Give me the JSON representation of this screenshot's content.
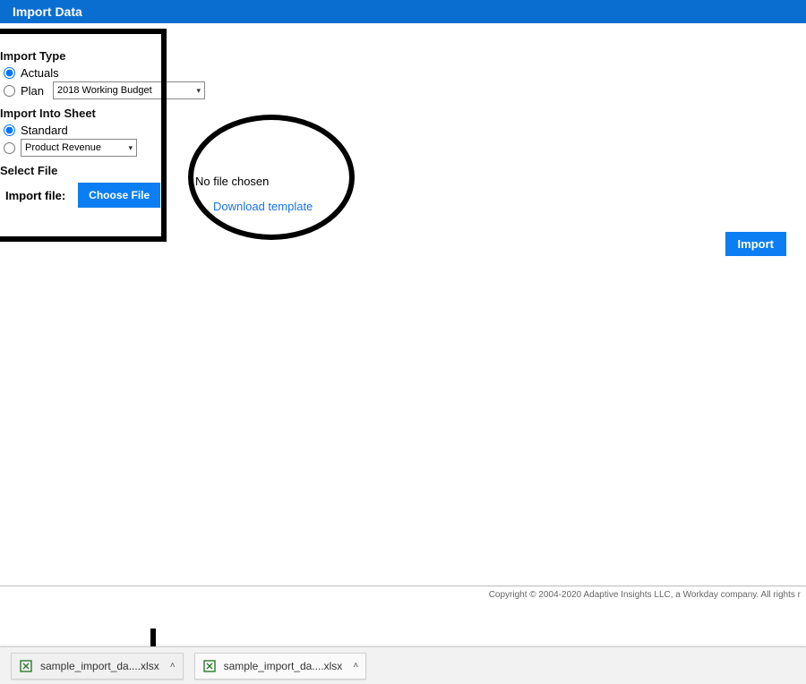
{
  "header": {
    "title": "Import Data"
  },
  "importType": {
    "section": "Import Type",
    "actuals": "Actuals",
    "plan": "Plan",
    "planSelect": "2018 Working Budget"
  },
  "importInto": {
    "section": "Import Into Sheet",
    "standard": "Standard",
    "sheetSelect": "Product Revenue"
  },
  "selectFile": {
    "section": "Select File",
    "label": "Import file:",
    "choose": "Choose File",
    "noFile": "No file chosen",
    "download": "Download template"
  },
  "actions": {
    "import": "Import"
  },
  "footer": {
    "copyright": "Copyright © 2004-2020 Adaptive Insights LLC, a Workday company. All rights r"
  },
  "downloads": {
    "item1": "sample_import_da....xlsx",
    "item2": "sample_import_da....xlsx"
  }
}
